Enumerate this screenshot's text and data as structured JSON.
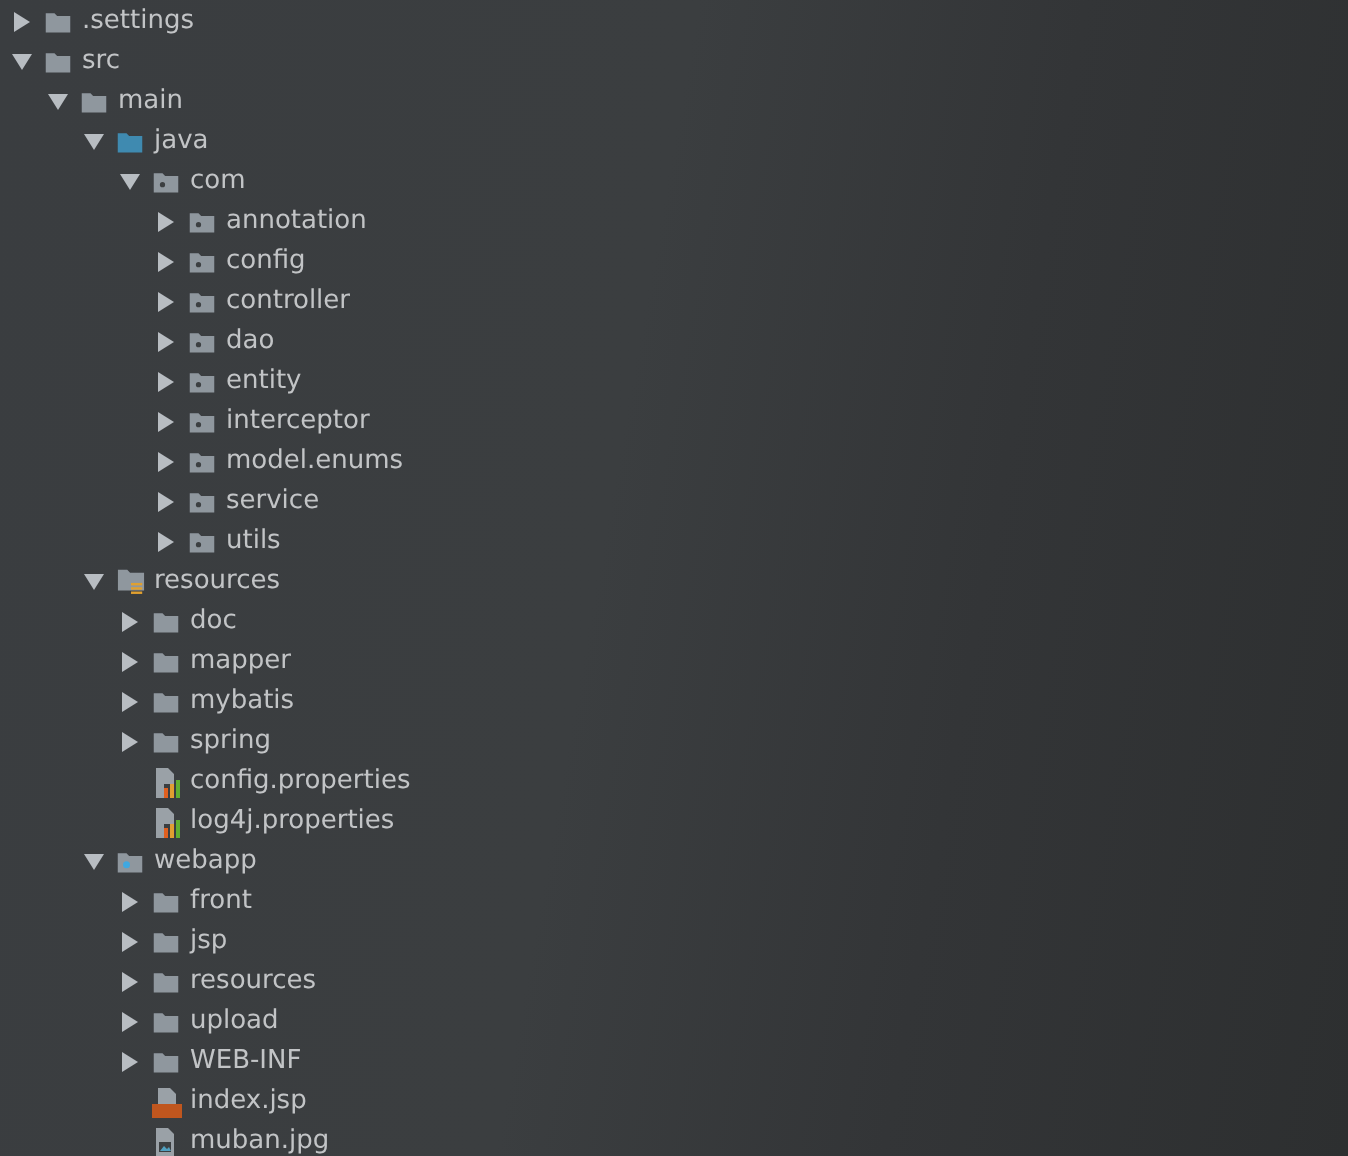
{
  "tree": [
    {
      "label": ".settings",
      "kind": "folder",
      "expanded": false
    },
    {
      "label": "src",
      "kind": "folder",
      "expanded": true,
      "children": [
        {
          "label": "main",
          "kind": "folder",
          "expanded": true,
          "children": [
            {
              "label": "java",
              "kind": "source",
              "expanded": true,
              "children": [
                {
                  "label": "com",
                  "kind": "package",
                  "expanded": true,
                  "children": [
                    {
                      "label": "annotation",
                      "kind": "package",
                      "expanded": false
                    },
                    {
                      "label": "config",
                      "kind": "package",
                      "expanded": false
                    },
                    {
                      "label": "controller",
                      "kind": "package",
                      "expanded": false
                    },
                    {
                      "label": "dao",
                      "kind": "package",
                      "expanded": false
                    },
                    {
                      "label": "entity",
                      "kind": "package",
                      "expanded": false
                    },
                    {
                      "label": "interceptor",
                      "kind": "package",
                      "expanded": false
                    },
                    {
                      "label": "model.enums",
                      "kind": "package",
                      "expanded": false
                    },
                    {
                      "label": "service",
                      "kind": "package",
                      "expanded": false
                    },
                    {
                      "label": "utils",
                      "kind": "package",
                      "expanded": false
                    }
                  ]
                }
              ]
            },
            {
              "label": "resources",
              "kind": "resources",
              "expanded": true,
              "children": [
                {
                  "label": "doc",
                  "kind": "folder",
                  "expanded": false
                },
                {
                  "label": "mapper",
                  "kind": "folder",
                  "expanded": false
                },
                {
                  "label": "mybatis",
                  "kind": "folder",
                  "expanded": false
                },
                {
                  "label": "spring",
                  "kind": "folder",
                  "expanded": false
                },
                {
                  "label": "config.properties",
                  "kind": "properties"
                },
                {
                  "label": "log4j.properties",
                  "kind": "properties"
                }
              ]
            },
            {
              "label": "webapp",
              "kind": "web",
              "expanded": true,
              "children": [
                {
                  "label": "front",
                  "kind": "folder",
                  "expanded": false
                },
                {
                  "label": "jsp",
                  "kind": "folder",
                  "expanded": false
                },
                {
                  "label": "resources",
                  "kind": "folder",
                  "expanded": false
                },
                {
                  "label": "upload",
                  "kind": "folder",
                  "expanded": false
                },
                {
                  "label": "WEB-INF",
                  "kind": "folder",
                  "expanded": false
                },
                {
                  "label": "index.jsp",
                  "kind": "jsp"
                },
                {
                  "label": "muban.jpg",
                  "kind": "image"
                }
              ]
            }
          ]
        }
      ]
    }
  ]
}
